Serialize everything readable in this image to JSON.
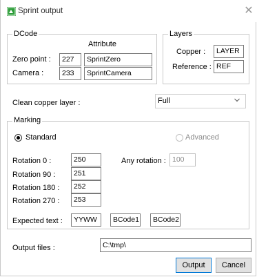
{
  "window": {
    "title": "Sprint output"
  },
  "dcode": {
    "legend": "DCode",
    "attribute_header": "Attribute",
    "zero_point": {
      "label": "Zero point :",
      "value": "227",
      "attribute": "SprintZero"
    },
    "camera": {
      "label": "Camera :",
      "value": "233",
      "attribute": "SprintCamera"
    }
  },
  "layers": {
    "legend": "Layers",
    "copper": {
      "label": "Copper :",
      "value": "LAYER"
    },
    "reference": {
      "label": "Reference :",
      "value": "REF"
    }
  },
  "clean_copper": {
    "label": "Clean copper layer :",
    "selected": "Full"
  },
  "marking": {
    "legend": "Marking",
    "standard_label": "Standard",
    "advanced_label": "Advanced",
    "rotations": [
      {
        "label": "Rotation 0 :",
        "value": "250"
      },
      {
        "label": "Rotation 90 :",
        "value": "251"
      },
      {
        "label": "Rotation 180 :",
        "value": "252"
      },
      {
        "label": "Rotation 270 :",
        "value": "253"
      }
    ],
    "any_rotation": {
      "label": "Any rotation :",
      "value": "100"
    },
    "expected_text": {
      "label": "Expected text :",
      "values": [
        "YYWW",
        "BCode1",
        "BCode2"
      ]
    }
  },
  "output_files": {
    "label": "Output files :",
    "value": "C:\\tmp\\"
  },
  "buttons": {
    "output": "Output",
    "cancel": "Cancel"
  },
  "colors": {
    "icon_green": "#2e9e3a",
    "default_border": "#0078d7"
  }
}
